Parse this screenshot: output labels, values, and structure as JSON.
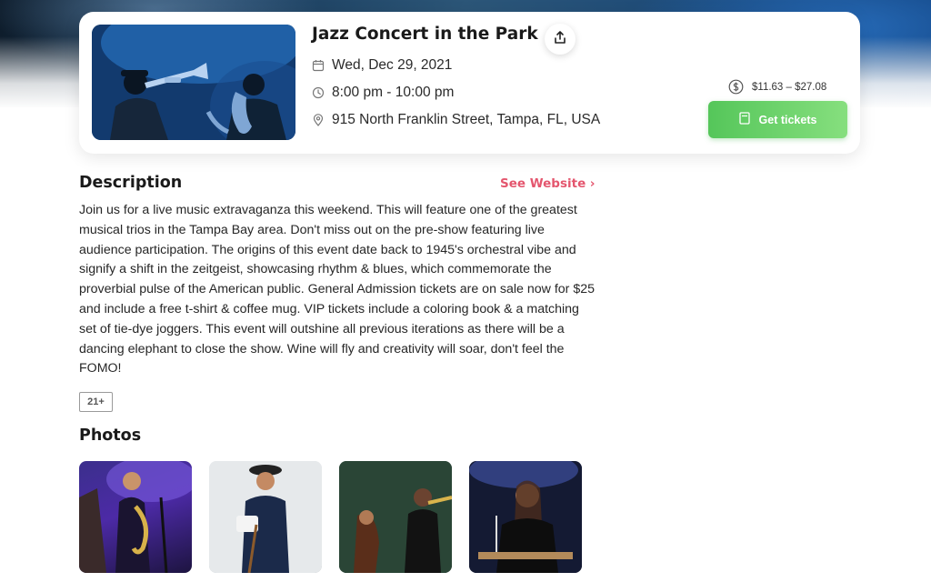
{
  "event": {
    "title": "Jazz Concert in the Park",
    "image_icon": "jazz-musicians-photo",
    "date": "Wed, Dec 29, 2021",
    "time": "8:00 pm - 10:00 pm",
    "location": "915 North Franklin Street, Tampa, FL, USA",
    "price_range": "$11.63 – $27.08",
    "get_tickets_label": "Get tickets"
  },
  "icons": {
    "share": "share-icon",
    "calendar": "calendar-icon",
    "clock": "clock-icon",
    "location": "location-pin-icon",
    "price": "dollar-circle-icon",
    "ticket": "ticket-icon"
  },
  "description": {
    "heading": "Description",
    "see_website_label": "See Website ›",
    "body": "Join us for a live music extravaganza this weekend. This will feature one of the greatest musical trios in the Tampa Bay area. Don't miss out on the pre-show featuring live audience participation. The origins of this event date back to 1945's orchestral vibe and signify a shift in the zeitgeist, showcasing rhythm & blues, which commemorate the proverbial pulse of the American public. General Admission tickets are on sale now for $25 and include a free t-shirt & coffee mug. VIP tickets include a coloring book & a matching set of tie-dye joggers. This event will outshine all previous iterations as there will be a dancing elephant to close the show. Wine will fly and creativity will soar, don't feel the FOMO!",
    "age_badge": "21+"
  },
  "photos": {
    "heading": "Photos",
    "items": [
      "band-saxophone-photo",
      "guitar-player-photo",
      "bass-trumpet-photo",
      "vibraphone-player-photo"
    ]
  },
  "colors": {
    "accent_pink": "#e4566e",
    "button_green": "#5cc85e"
  }
}
